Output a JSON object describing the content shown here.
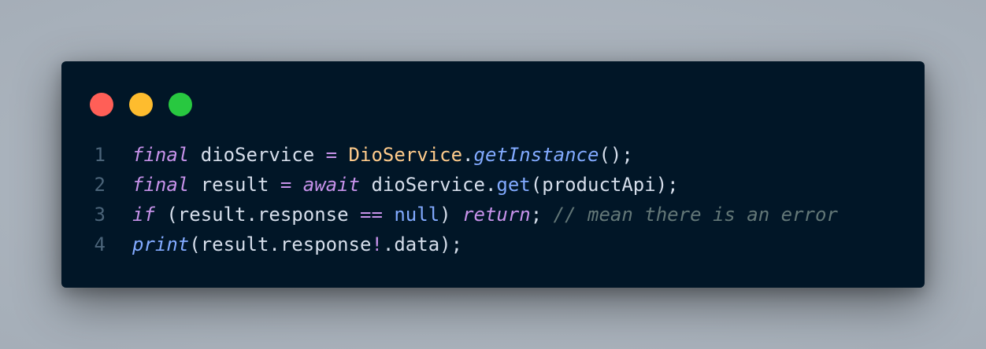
{
  "window": {
    "controls": [
      {
        "name": "close",
        "color": "#ff5f57"
      },
      {
        "name": "minimize",
        "color": "#febc2e"
      },
      {
        "name": "maximize",
        "color": "#28c840"
      }
    ]
  },
  "code": {
    "lines": [
      {
        "number": "1",
        "tokens": [
          {
            "text": "final",
            "kind": "kw"
          },
          {
            "text": " dioService ",
            "kind": "plain"
          },
          {
            "text": "=",
            "kind": "op"
          },
          {
            "text": " ",
            "kind": "plain"
          },
          {
            "text": "DioService",
            "kind": "cls"
          },
          {
            "text": ".",
            "kind": "plain"
          },
          {
            "text": "getInstance",
            "kind": "fn"
          },
          {
            "text": "();",
            "kind": "plain"
          }
        ]
      },
      {
        "number": "2",
        "tokens": [
          {
            "text": "final",
            "kind": "kw"
          },
          {
            "text": " result ",
            "kind": "plain"
          },
          {
            "text": "=",
            "kind": "op"
          },
          {
            "text": " ",
            "kind": "plain"
          },
          {
            "text": "await",
            "kind": "kw"
          },
          {
            "text": " dioService.",
            "kind": "plain"
          },
          {
            "text": "get",
            "kind": "fn2"
          },
          {
            "text": "(productApi);",
            "kind": "plain"
          }
        ]
      },
      {
        "number": "3",
        "tokens": [
          {
            "text": "if",
            "kind": "kw"
          },
          {
            "text": " (result.response ",
            "kind": "plain"
          },
          {
            "text": "==",
            "kind": "op"
          },
          {
            "text": " ",
            "kind": "plain"
          },
          {
            "text": "null",
            "kind": "lit"
          },
          {
            "text": ") ",
            "kind": "plain"
          },
          {
            "text": "return",
            "kind": "kw"
          },
          {
            "text": "; ",
            "kind": "plain"
          },
          {
            "text": "// mean there is an error",
            "kind": "cm"
          }
        ]
      },
      {
        "number": "4",
        "tokens": [
          {
            "text": "print",
            "kind": "fn"
          },
          {
            "text": "(result.response",
            "kind": "plain"
          },
          {
            "text": "!",
            "kind": "op"
          },
          {
            "text": ".data);",
            "kind": "plain"
          }
        ]
      }
    ]
  }
}
